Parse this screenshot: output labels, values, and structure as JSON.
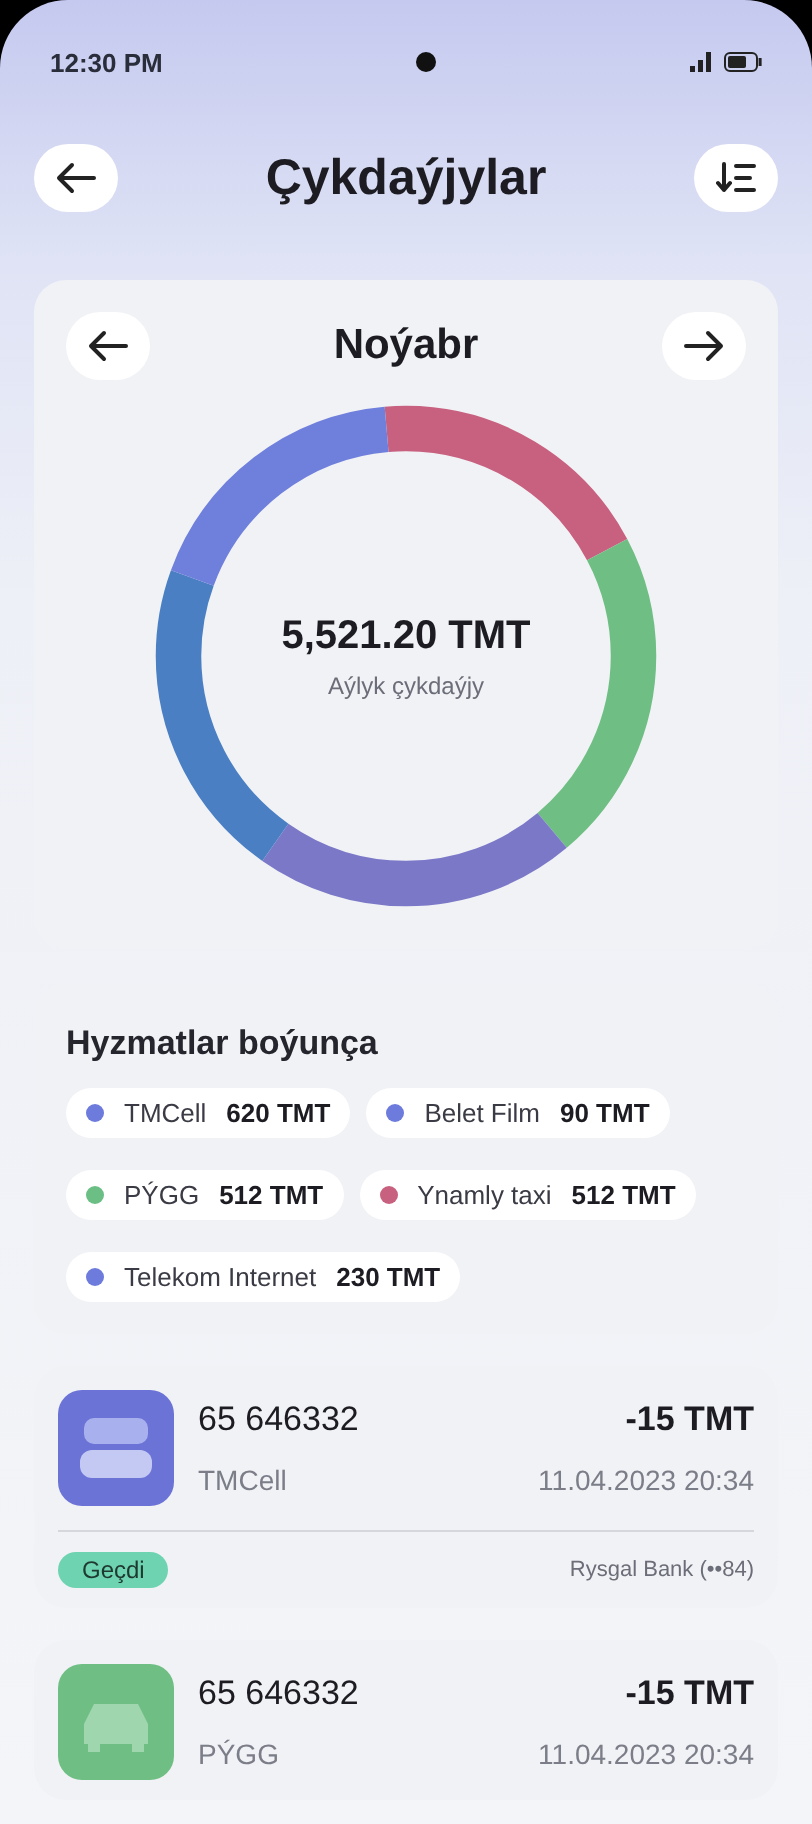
{
  "status_bar": {
    "time": "12:30 PM"
  },
  "header": {
    "title": "Çykdaýjylar"
  },
  "month_card": {
    "month": "Noýabr",
    "total": "5,521.20 TMT",
    "caption": "Aýlyk çykdaýjy"
  },
  "services": {
    "title": "Hyzmatlar boýunça",
    "items": [
      {
        "name": "TMCell",
        "amount": "620 TMT",
        "color": "#6c7bdc"
      },
      {
        "name": "Belet Film",
        "amount": "90 TMT",
        "color": "#6c7bdc"
      },
      {
        "name": "PÝGG",
        "amount": "512 TMT",
        "color": "#6bbf85"
      },
      {
        "name": "Ynamly taxi",
        "amount": "512 TMT",
        "color": "#c8607f"
      },
      {
        "name": "Telekom Internet",
        "amount": "230 TMT",
        "color": "#6c7bdc"
      }
    ]
  },
  "transactions": [
    {
      "kind": "sim",
      "number": "65 646332",
      "amount": "-15 TMT",
      "service": "TMCell",
      "date": "11.04.2023 20:34",
      "status": "Geçdi",
      "bank": "Rysgal Bank (••84)"
    },
    {
      "kind": "car",
      "number": "65 646332",
      "amount": "-15 TMT",
      "service": "PÝGG",
      "date": "11.04.2023 20:34"
    }
  ]
}
